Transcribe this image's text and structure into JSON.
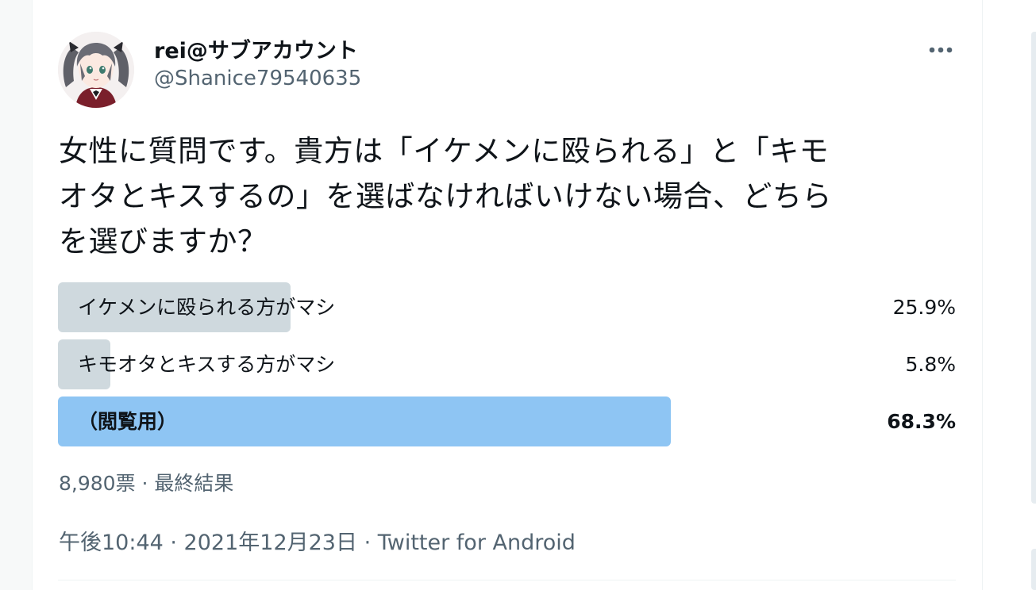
{
  "user": {
    "display_name": "rei@サブアカウント",
    "handle": "@Shanice79540635"
  },
  "tweet": {
    "text_lines": [
      "女性に質問です。貴方は「イケメンに殴られる」と「キモ",
      "オタとキスするの」を選ばなければいけない場合、どちら",
      "を選びますか？"
    ]
  },
  "poll": {
    "options": [
      {
        "label": "イケメンに殴られる方がマシ",
        "percent_text": "25.9%",
        "percent": 25.9,
        "winner": false
      },
      {
        "label": "キモオタとキスする方がマシ",
        "percent_text": "5.8%",
        "percent": 5.8,
        "winner": false
      },
      {
        "label": "（閲覧用）",
        "percent_text": "68.3%",
        "percent": 68.3,
        "winner": true
      }
    ],
    "meta": "8,980票 · 最終結果"
  },
  "timestamp": "午後10:44 · 2021年12月23日 · Twitter for Android",
  "icons": {
    "more": "more-horizontal-icon",
    "avatar": "anime-avatar"
  },
  "colors": {
    "bar_default": "#cfd9de",
    "bar_winner": "#8ec5f3",
    "secondary_text": "#536471",
    "primary_text": "#0f1419"
  }
}
